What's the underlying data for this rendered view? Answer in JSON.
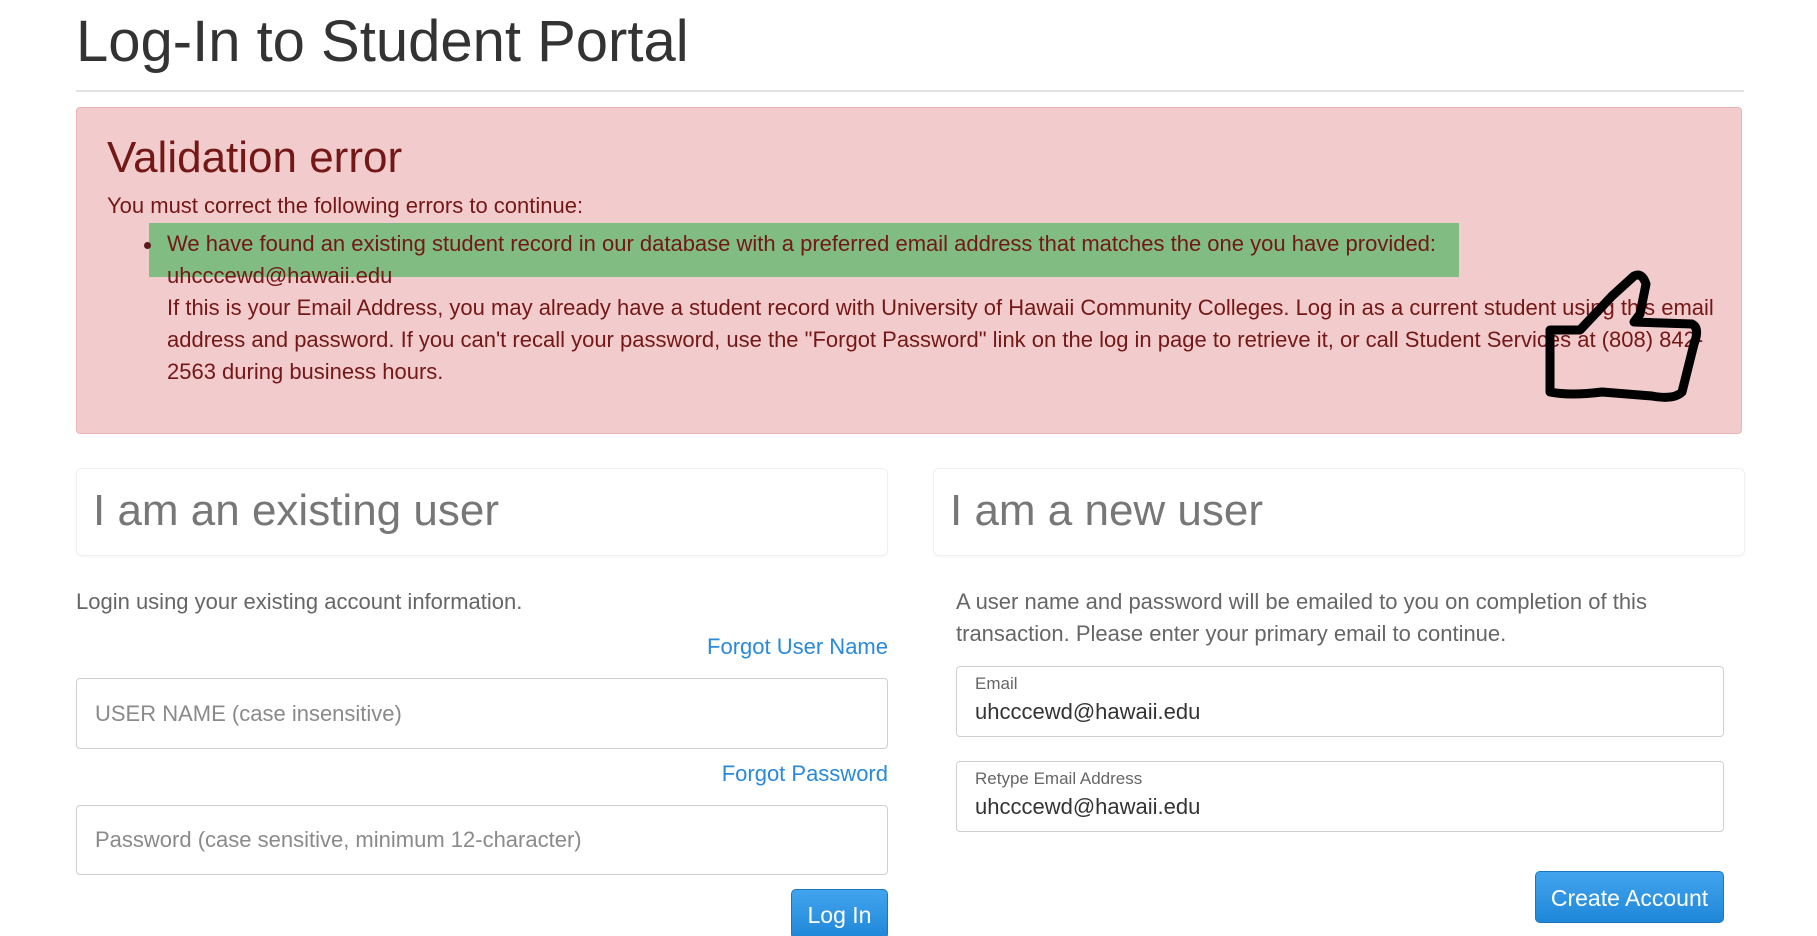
{
  "page": {
    "title": "Log-In to Student Portal"
  },
  "alert": {
    "heading": "Validation error",
    "intro": "You must correct the following errors to continue:",
    "items": [
      {
        "line1": "We have found an existing student record in our database with a preferred email address that matches the one you have provided:",
        "email": "uhcccewd@hawaii.edu",
        "body": "If this is your Email Address, you may already have a student record with University of Hawaii Community Colleges. Log in as a current student using this email address and password. If you can't recall your password, use the \"Forgot Password\" link on the log in page to retrieve it, or call Student Services at (808) 842-2563 during business hours."
      }
    ],
    "highlight_color": "#5bb86a",
    "annotation_icon": "thumbs-up-icon"
  },
  "existing_user": {
    "heading": "I am an existing user",
    "description": "Login using your existing account information.",
    "forgot_username_link": "Forgot User Name",
    "username_placeholder": "USER NAME (case insensitive)",
    "username_value": "",
    "forgot_password_link": "Forgot Password",
    "password_placeholder": "Password (case sensitive, minimum 12-character)",
    "password_value": "",
    "login_button": "Log In"
  },
  "new_user": {
    "heading": "I am a new user",
    "description": "A user name and password will be emailed to you on completion of this transaction. Please enter your primary email to continue.",
    "email_label": "Email",
    "email_value": "uhcccewd@hawaii.edu",
    "retype_email_label": "Retype Email Address",
    "retype_email_value": "uhcccewd@hawaii.edu",
    "create_button": "Create Account"
  },
  "colors": {
    "alert_background": "#f2cccc",
    "alert_text": "#731717",
    "link": "#2a8ad8",
    "button": "#2a8ad8"
  }
}
